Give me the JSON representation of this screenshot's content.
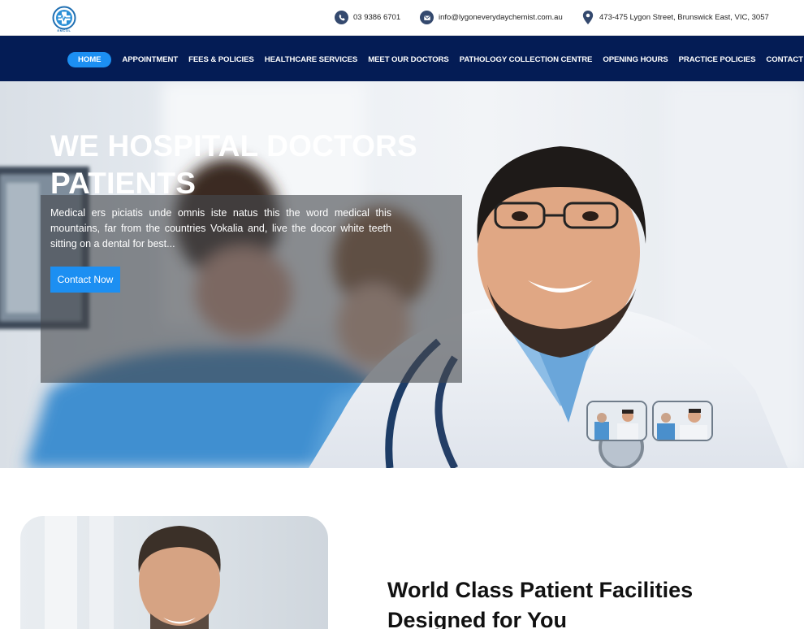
{
  "logo": {
    "abbr": "EMCOL"
  },
  "contact": {
    "phone": "03 9386 6701",
    "email": "info@lygoneverydaychemist.com.au",
    "address": "473-475 Lygon Street, Brunswick East, VIC, 3057"
  },
  "nav": {
    "items": [
      {
        "label": "HOME",
        "active": true
      },
      {
        "label": "APPOINTMENT"
      },
      {
        "label": "FEES & POLICIES"
      },
      {
        "label": "HEALTHCARE SERVICES"
      },
      {
        "label": "MEET OUR DOCTORS"
      },
      {
        "label": "PATHOLOGY COLLECTION CENTRE"
      },
      {
        "label": "OPENING HOURS"
      },
      {
        "label": "PRACTICE POLICIES"
      },
      {
        "label": "CONTACT US"
      }
    ]
  },
  "hero": {
    "title": "WE HOSPITAL DOCTORS PATIENTS",
    "text": "Medical ers piciatis unde omnis iste natus this the word medical this mountains, far from the countries Vokalia and, live the docor white teeth sitting on a dental for best...",
    "button": "Contact Now"
  },
  "about": {
    "title": "World Class Patient Facilities Designed for You"
  },
  "colors": {
    "nav_bg": "#041c55",
    "accent": "#1c8ff2",
    "icon": "#34496e"
  },
  "icons": [
    "phone-icon",
    "mail-icon",
    "location-icon"
  ]
}
